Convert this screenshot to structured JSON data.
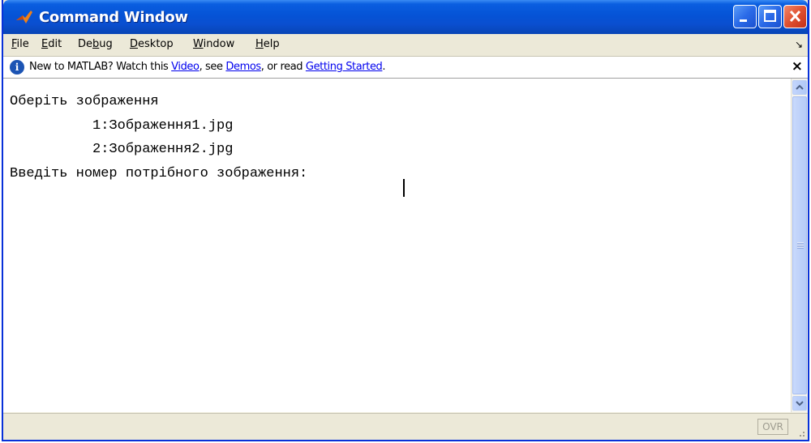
{
  "window": {
    "title": "Command Window",
    "icon": "matlab-logo-icon"
  },
  "menu": {
    "items": [
      {
        "label": "File",
        "hotkey": "F",
        "rest": "ile"
      },
      {
        "label": "Edit",
        "hotkey": "E",
        "rest": "dit"
      },
      {
        "label": "Debug",
        "pre": "De",
        "hotkey": "b",
        "rest": "ug"
      },
      {
        "label": "Desktop",
        "hotkey": "D",
        "rest": "esktop"
      },
      {
        "label": "Window",
        "hotkey": "W",
        "rest": "indow"
      },
      {
        "label": "Help",
        "hotkey": "H",
        "rest": "elp"
      }
    ]
  },
  "infobar": {
    "text_before": "New to MATLAB? Watch this ",
    "link_video": "Video",
    "text_mid1": ", see ",
    "link_demos": "Demos",
    "text_mid2": ", or read ",
    "link_getting_started": "Getting Started",
    "text_after": ".",
    "close_label": "×"
  },
  "console": {
    "lines": [
      "Оберіть зображення",
      "          1:Зображення1.jpg",
      "          2:Зображення2.jpg",
      "Введіть номер потрібного зображення:  "
    ]
  },
  "status": {
    "ovr_label": "OVR"
  }
}
